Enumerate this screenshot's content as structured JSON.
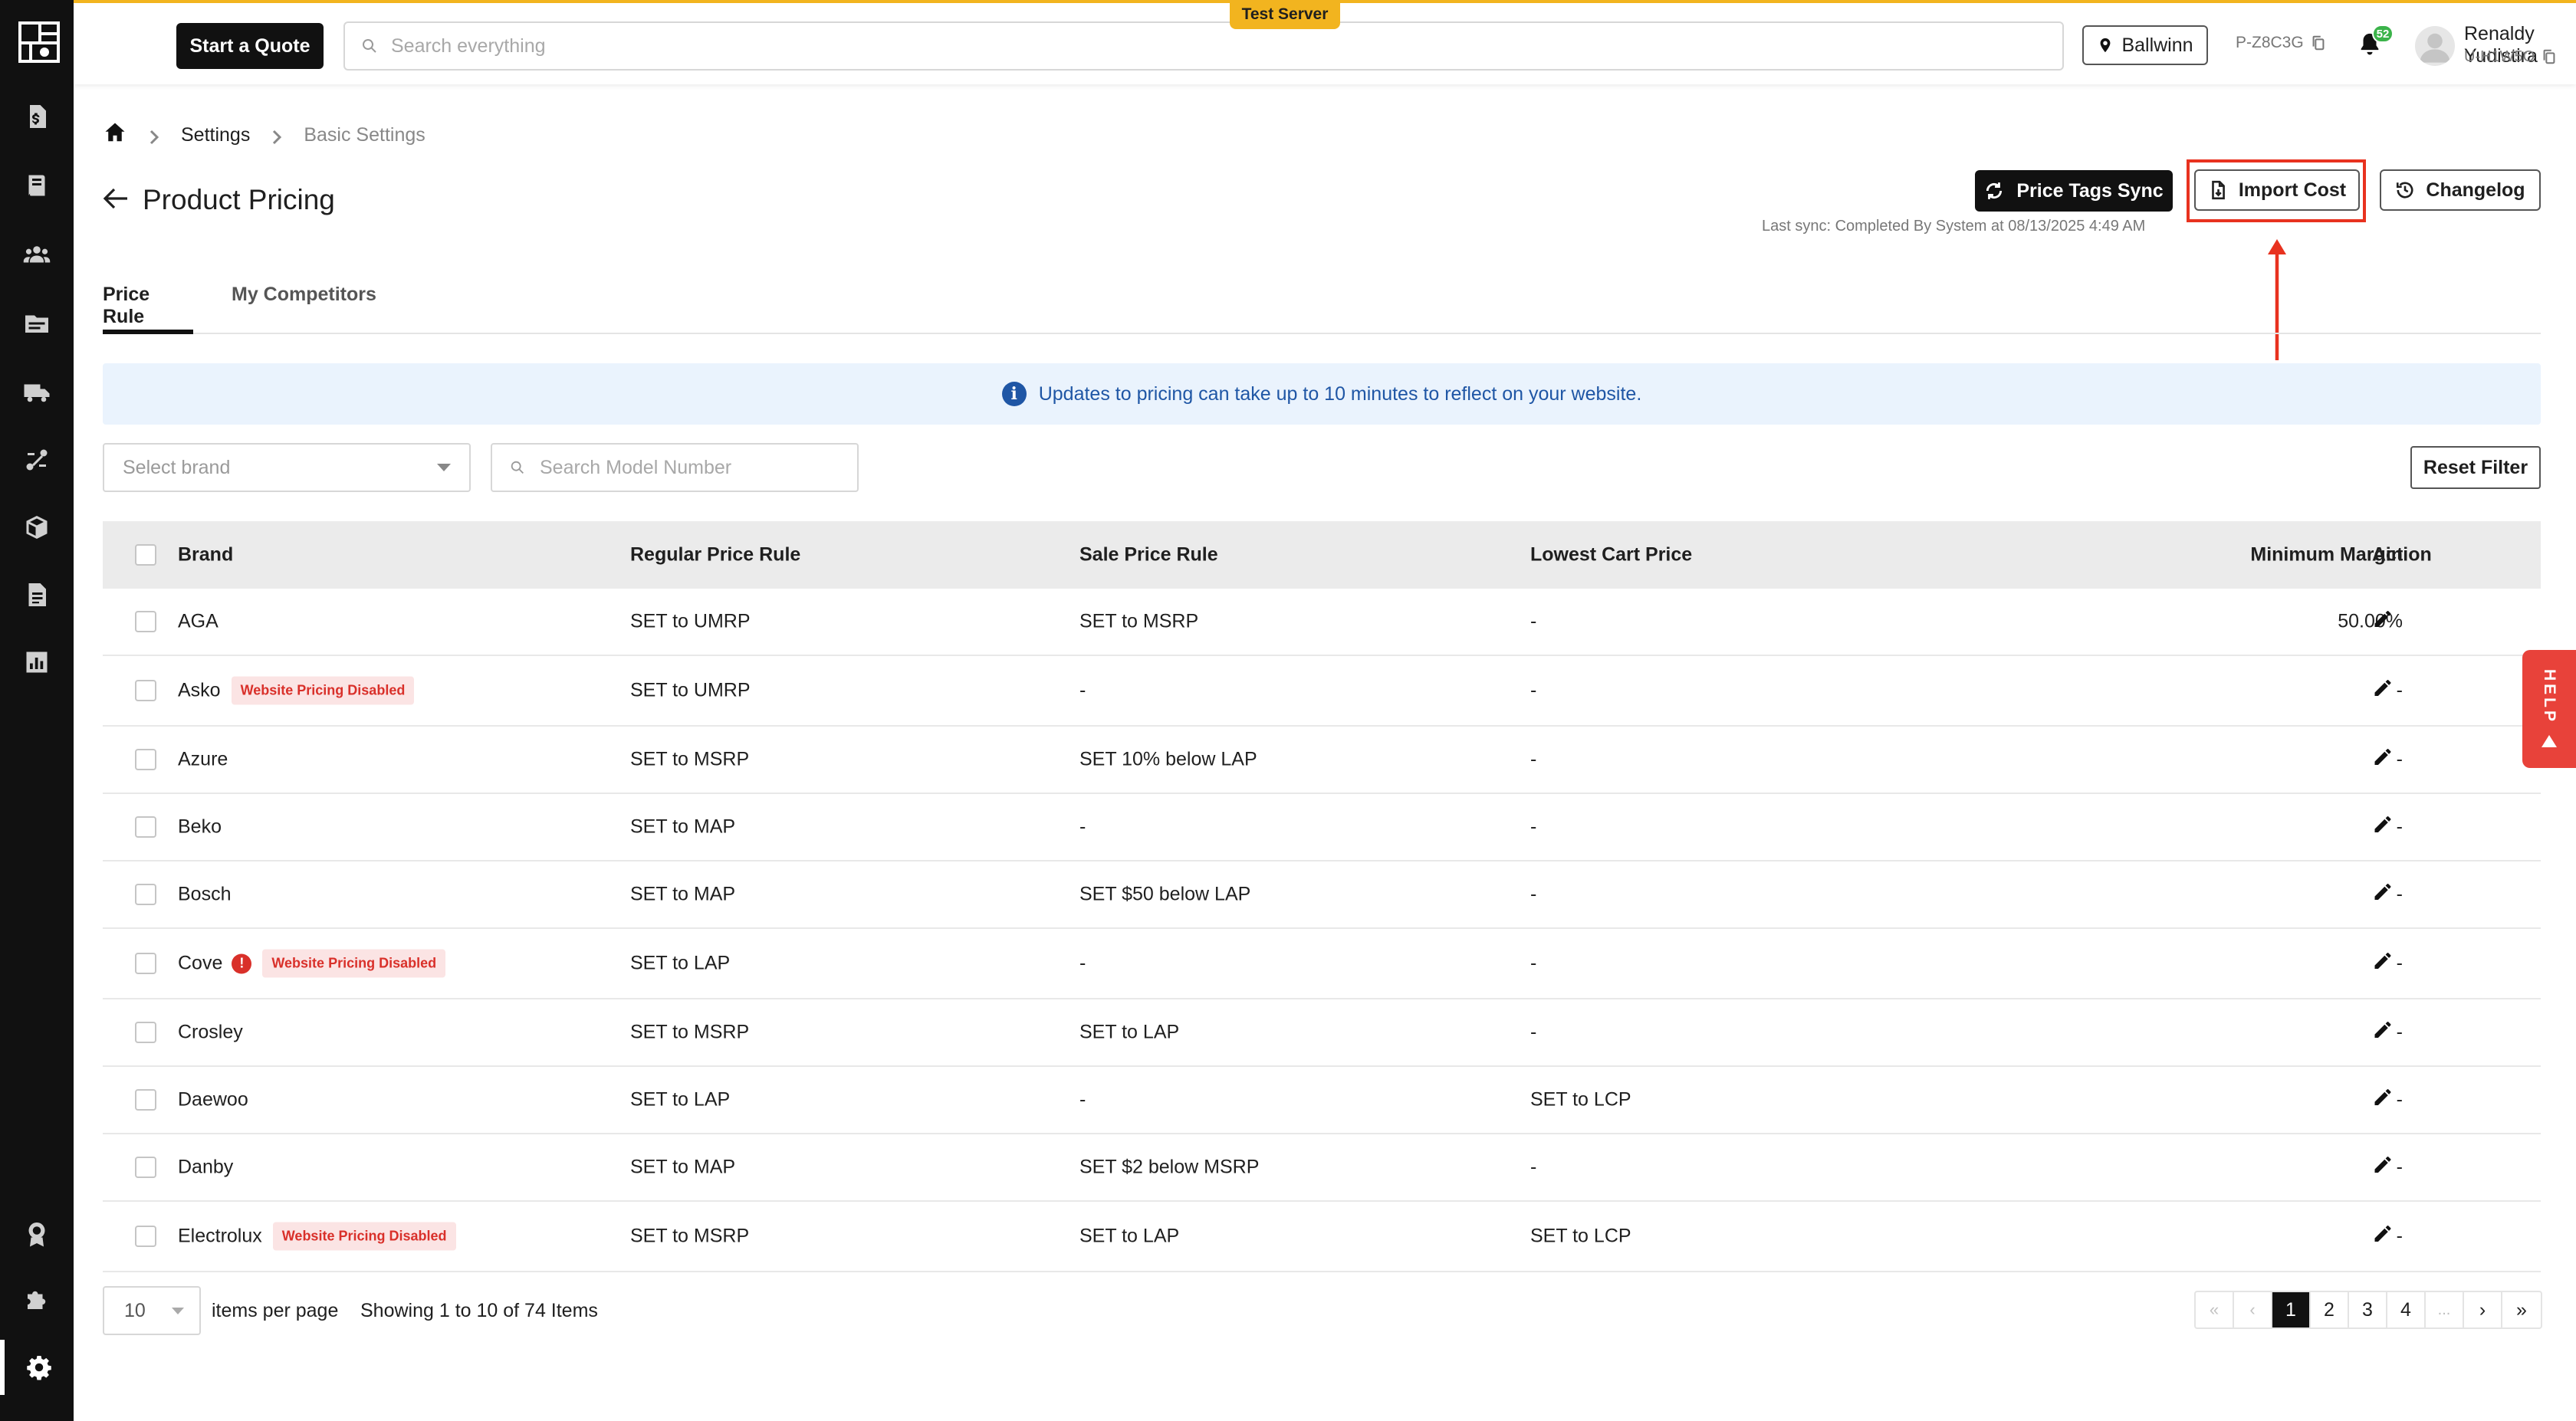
{
  "topbar": {
    "test_server": "Test Server",
    "start_quote": "Start a Quote",
    "search_placeholder": "Search everything",
    "location": "Ballwinn",
    "project_code": "P-Z8C3G",
    "notification_count": "52",
    "user_name": "Renaldy Yudistira",
    "user_id": "U-H1W5O"
  },
  "sidebar": {
    "items": [
      {
        "icon": "dollar-doc-icon"
      },
      {
        "icon": "book-icon"
      },
      {
        "icon": "users-icon"
      },
      {
        "icon": "folder-icon"
      },
      {
        "icon": "truck-icon"
      },
      {
        "icon": "route-icon"
      },
      {
        "icon": "box-icon"
      },
      {
        "icon": "document-icon"
      },
      {
        "icon": "chart-icon"
      },
      {
        "icon": "award-icon"
      },
      {
        "icon": "puzzle-icon"
      },
      {
        "icon": "gear-icon",
        "active": true
      }
    ]
  },
  "breadcrumb": {
    "settings": "Settings",
    "current": "Basic Settings"
  },
  "page": {
    "title": "Product Pricing",
    "price_tags_sync": "Price Tags Sync",
    "import_cost": "Import Cost",
    "changelog": "Changelog",
    "last_sync": "Last sync: Completed By System at 08/13/2025 4:49 AM"
  },
  "tabs": [
    {
      "label": "Price Rule",
      "active": true
    },
    {
      "label": "My Competitors",
      "active": false
    }
  ],
  "banner": {
    "icon": "i",
    "text": "Updates to pricing can take up to 10 minutes to reflect on your website."
  },
  "filters": {
    "brand_placeholder": "Select brand",
    "model_placeholder": "Search Model Number",
    "reset": "Reset Filter"
  },
  "table": {
    "headers": {
      "brand": "Brand",
      "regular": "Regular Price Rule",
      "sale": "Sale Price Rule",
      "lcp": "Lowest Cart Price",
      "margin": "Minimum Margin",
      "action": "Action"
    },
    "disabled_label": "Website Pricing Disabled",
    "warning_symbol": "!",
    "rows": [
      {
        "brand": "AGA",
        "regular": "SET to UMRP",
        "sale": "SET to MSRP",
        "lcp": "-",
        "margin": "50.00%"
      },
      {
        "brand": "Asko",
        "regular": "SET to UMRP",
        "sale": "-",
        "lcp": "-",
        "margin": "-",
        "disabled": true
      },
      {
        "brand": "Azure",
        "regular": "SET to MSRP",
        "sale": "SET 10% below LAP",
        "lcp": "-",
        "margin": "-"
      },
      {
        "brand": "Beko",
        "regular": "SET to MAP",
        "sale": "-",
        "lcp": "-",
        "margin": "-"
      },
      {
        "brand": "Bosch",
        "regular": "SET to MAP",
        "sale": "SET $50 below LAP",
        "lcp": "-",
        "margin": "-"
      },
      {
        "brand": "Cove",
        "regular": "SET to LAP",
        "sale": "-",
        "lcp": "-",
        "margin": "-",
        "disabled": true,
        "warning": true
      },
      {
        "brand": "Crosley",
        "regular": "SET to MSRP",
        "sale": "SET to LAP",
        "lcp": "-",
        "margin": "-"
      },
      {
        "brand": "Daewoo",
        "regular": "SET to LAP",
        "sale": "-",
        "lcp": "SET to LCP",
        "margin": "-"
      },
      {
        "brand": "Danby",
        "regular": "SET to MAP",
        "sale": "SET $2 below MSRP",
        "lcp": "-",
        "margin": "-"
      },
      {
        "brand": "Electrolux",
        "regular": "SET to MSRP",
        "sale": "SET to LAP",
        "lcp": "SET to LCP",
        "margin": "-",
        "disabled": true
      }
    ]
  },
  "pagination": {
    "per_page": "10",
    "items_per_page_label": "items per page",
    "showing": "Showing 1 to 10 of 74 Items",
    "first": "«",
    "prev": "‹",
    "pages": [
      "1",
      "2",
      "3",
      "4"
    ],
    "current": "1",
    "ellipsis": "...",
    "next": "›",
    "last": "»"
  },
  "help": {
    "label": "HELP"
  },
  "colors": {
    "accent_yellow": "#f2b41f",
    "highlight_red": "#e8321f",
    "info_blue": "#1f56a5",
    "danger": "#d9302a"
  }
}
